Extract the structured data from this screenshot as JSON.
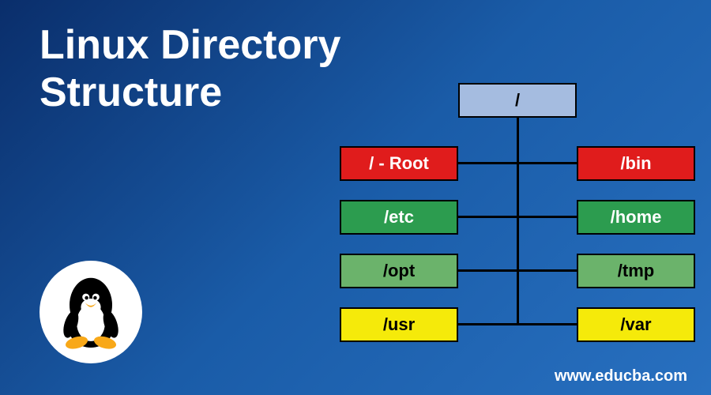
{
  "title_line1": "Linux Directory",
  "title_line2": "Structure",
  "footer": "www.educba.com",
  "diagram": {
    "root": "/",
    "rows": [
      {
        "left": "/ - Root",
        "right": "/bin",
        "color": "red"
      },
      {
        "left": "/etc",
        "right": "/home",
        "color": "green"
      },
      {
        "left": "/opt",
        "right": "/tmp",
        "color": "lgreen"
      },
      {
        "left": "/usr",
        "right": "/var",
        "color": "yellow"
      }
    ]
  },
  "icon": "tux-penguin"
}
